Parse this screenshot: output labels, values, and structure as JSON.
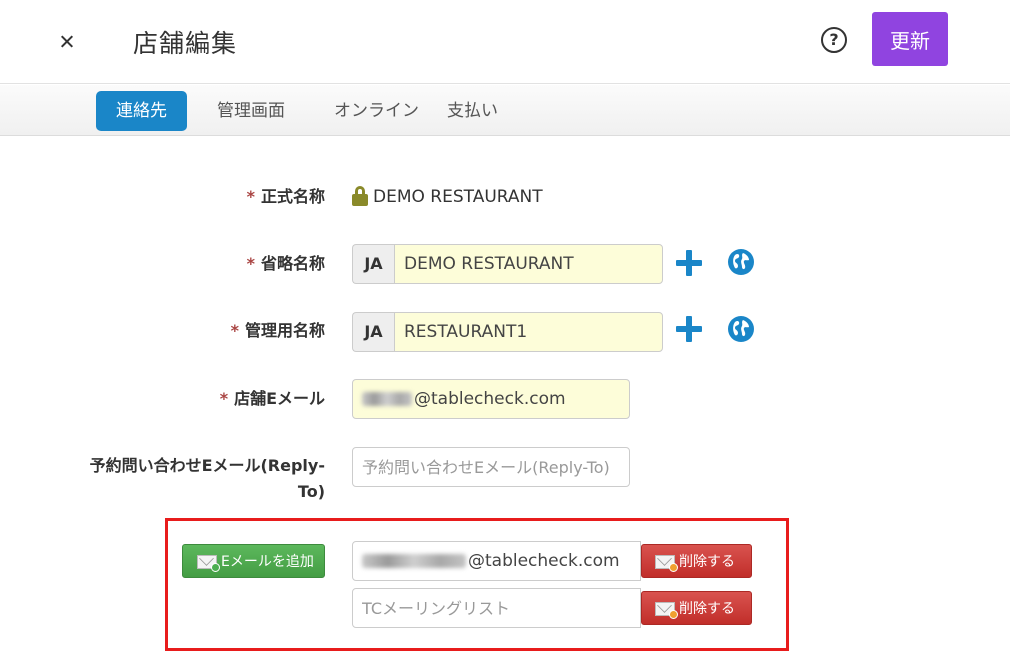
{
  "header": {
    "title": "店舗編集",
    "help_glyph": "?",
    "update_label": "更新"
  },
  "tabs": [
    {
      "label": "連絡先",
      "active": true
    },
    {
      "label": "管理画面",
      "active": false
    },
    {
      "label": "オンライン",
      "active": false
    },
    {
      "label": "支払い",
      "active": false
    }
  ],
  "form": {
    "required_mark": "*",
    "official_name": {
      "label": "正式名称",
      "value": "DEMO RESTAURANT"
    },
    "short_name": {
      "label": "省略名称",
      "lang": "JA",
      "value": "DEMO RESTAURANT"
    },
    "admin_name": {
      "label": "管理用名称",
      "lang": "JA",
      "value": "RESTAURANT1"
    },
    "store_email": {
      "label": "店舗Eメール",
      "domain": "@tablecheck.com"
    },
    "reply_to_email": {
      "label": "予約問い合わせEメール(Reply-To)",
      "placeholder": "予約問い合わせEメール(Reply-To)"
    },
    "add_email_label": "Eメールを追加",
    "extra_emails": [
      {
        "domain": "@tablecheck.com",
        "placeholder": "",
        "delete_label": "削除する"
      },
      {
        "domain": "",
        "placeholder": "TCメーリングリスト",
        "delete_label": "削除する"
      }
    ]
  },
  "colors": {
    "accent_blue": "#1a86c8",
    "update_purple": "#9044e0",
    "input_yellow": "#fdfdd9",
    "highlight_red": "#e81c1c"
  }
}
